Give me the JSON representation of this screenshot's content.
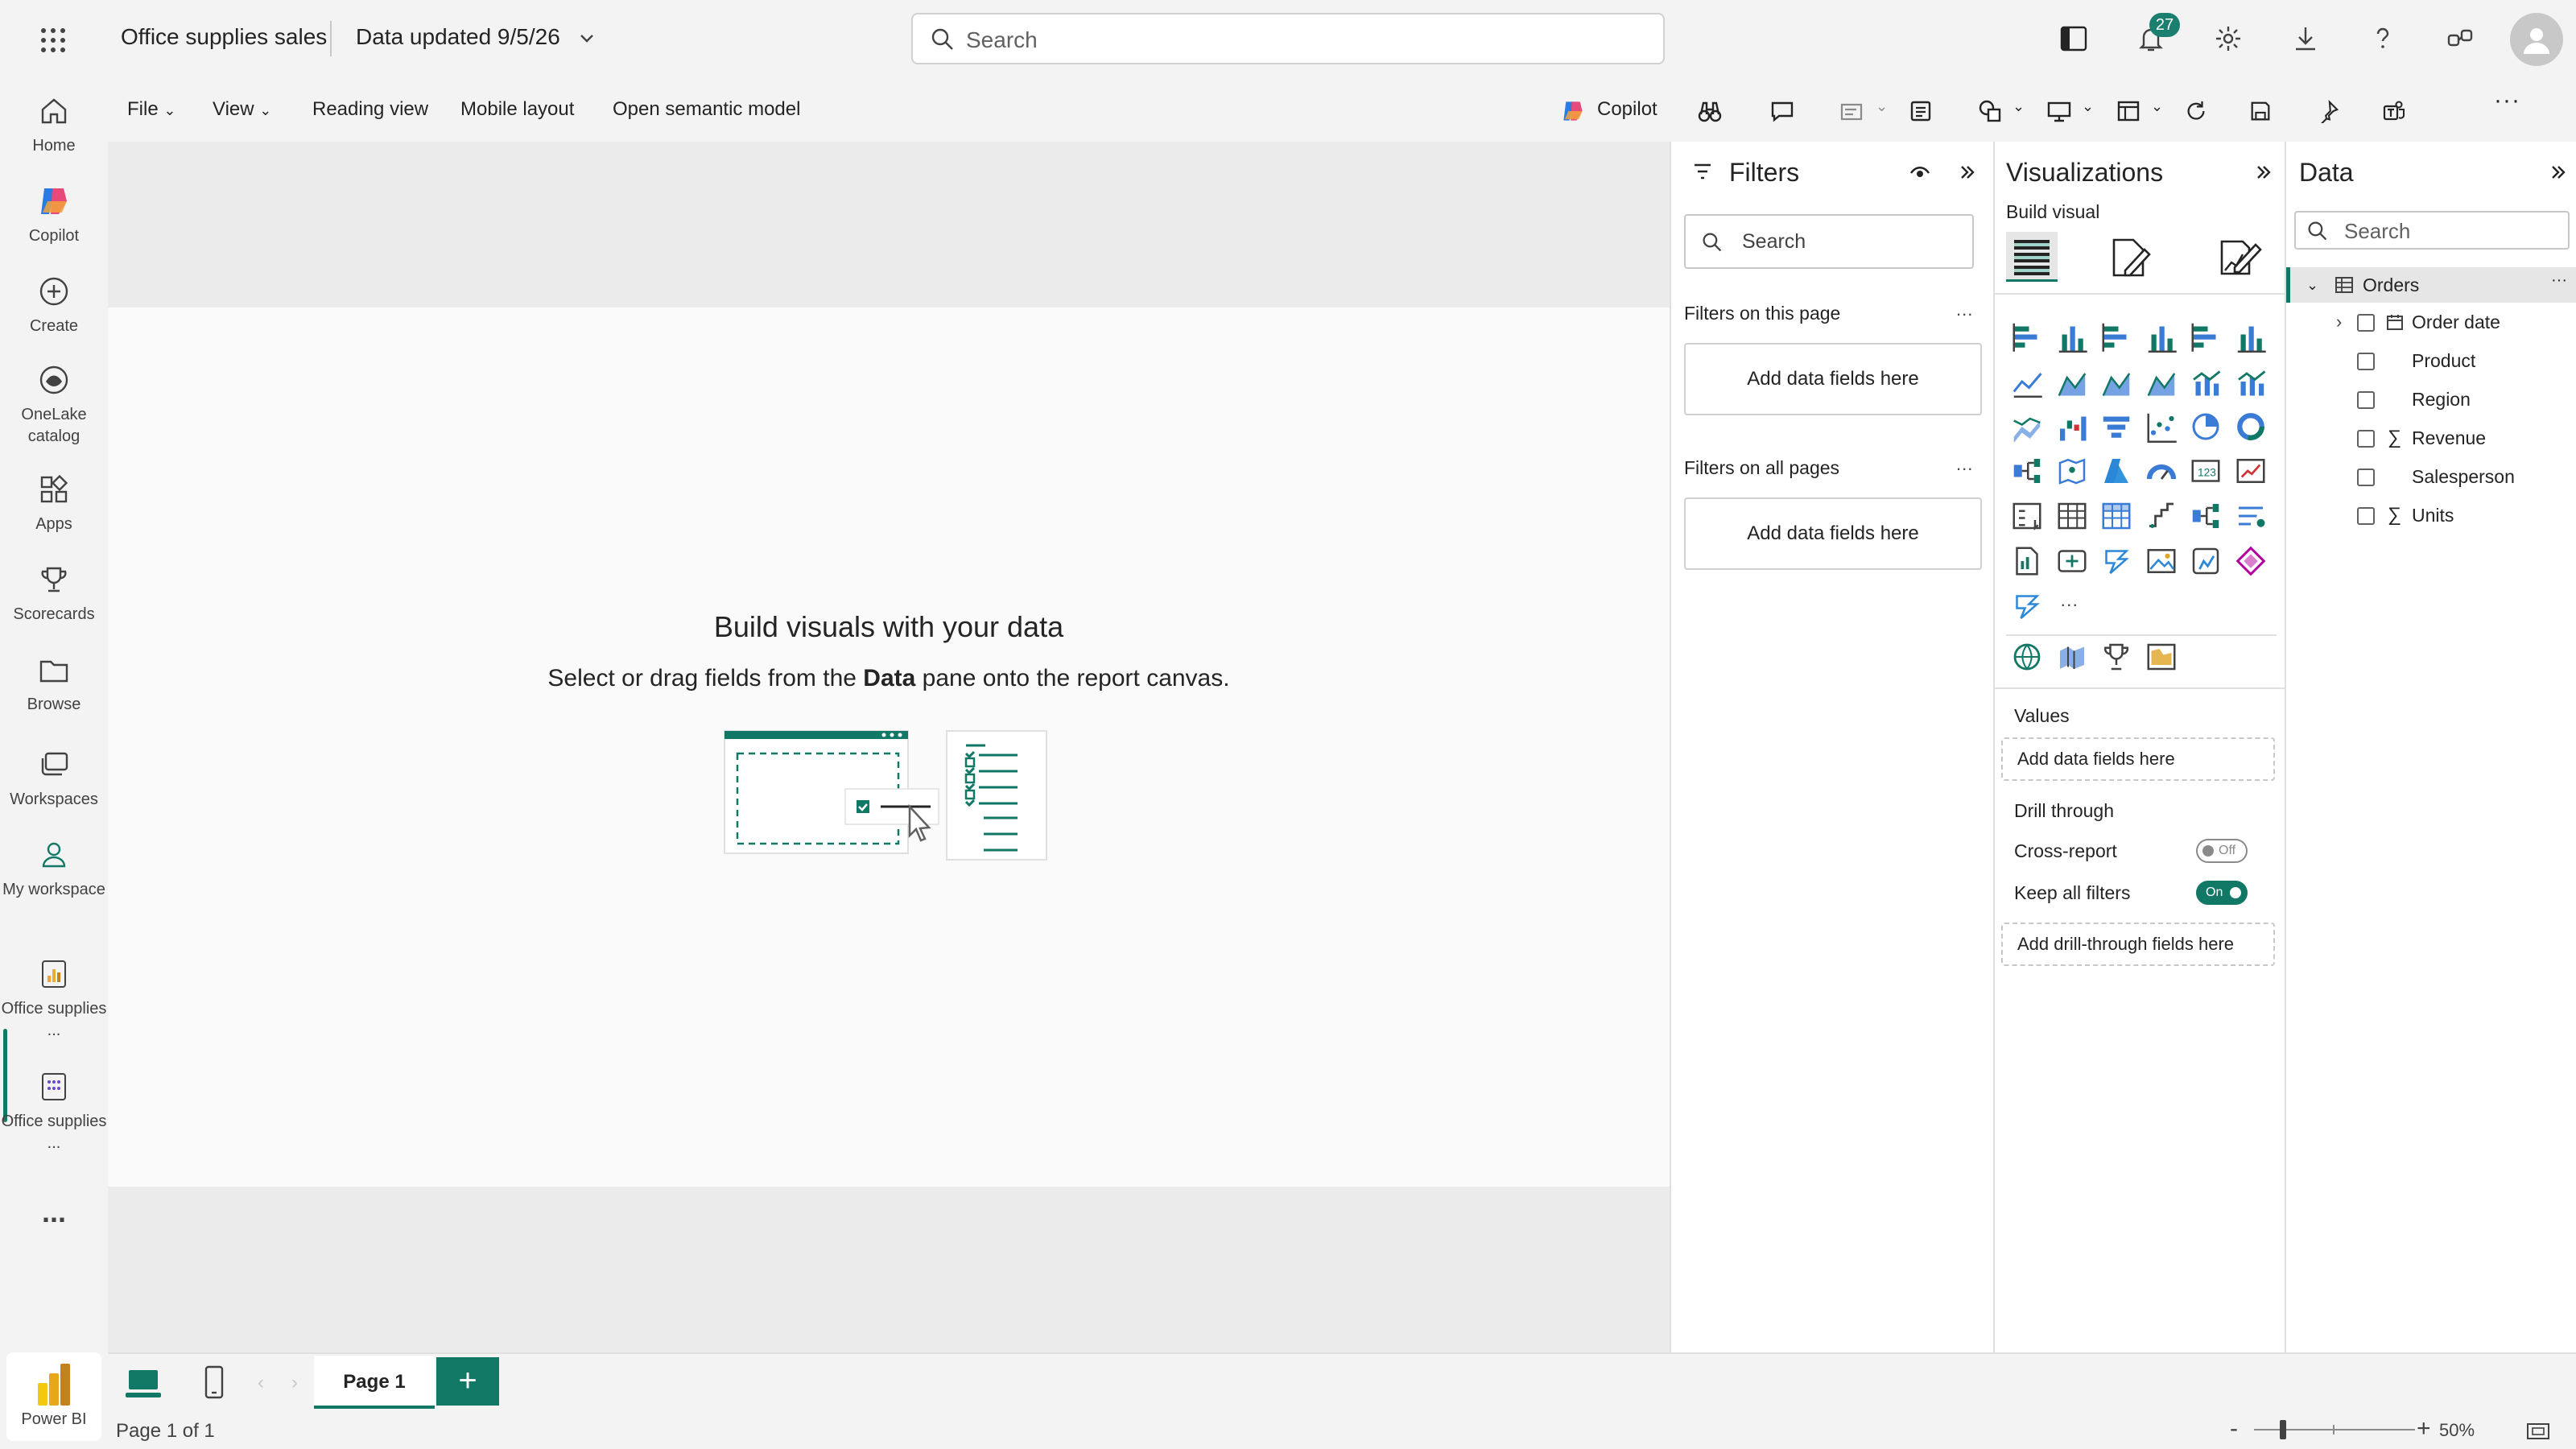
{
  "header": {
    "app_title": "Office supplies sales",
    "data_updated": "Data updated 9/5/26",
    "search_placeholder": "Search",
    "notification_count": "27"
  },
  "rail": {
    "items": [
      {
        "label": "Home",
        "icon": "home-icon"
      },
      {
        "label": "Copilot",
        "icon": "copilot-icon"
      },
      {
        "label": "Create",
        "icon": "create-icon"
      },
      {
        "label": "OneLake catalog",
        "icon": "onelake-icon"
      },
      {
        "label": "Apps",
        "icon": "apps-icon"
      },
      {
        "label": "Scorecards",
        "icon": "trophy-icon"
      },
      {
        "label": "Browse",
        "icon": "folder-icon"
      },
      {
        "label": "Workspaces",
        "icon": "workspaces-icon"
      },
      {
        "label": "My workspace",
        "icon": "person-icon"
      },
      {
        "label": "Office supplies ...",
        "icon": "report-icon"
      },
      {
        "label": "Office supplies ...",
        "icon": "semantic-model-icon"
      }
    ],
    "more": "...",
    "brand": "Power BI"
  },
  "ribbon": {
    "file": "File",
    "view": "View",
    "reading_view": "Reading view",
    "mobile_layout": "Mobile layout",
    "open_semantic_model": "Open semantic model",
    "copilot": "Copilot"
  },
  "canvas": {
    "empty_title": "Build visuals with your data",
    "empty_sub_pre": "Select or drag fields from the ",
    "empty_sub_bold": "Data",
    "empty_sub_post": " pane onto the report canvas."
  },
  "filters": {
    "title": "Filters",
    "search_placeholder": "Search",
    "on_this_page": "Filters on this page",
    "on_all_pages": "Filters on all pages",
    "add_fields": "Add data fields here",
    "more": "..."
  },
  "visualizations": {
    "title": "Visualizations",
    "build_visual": "Build visual",
    "values_label": "Values",
    "values_well": "Add data fields here",
    "drill_through": "Drill through",
    "cross_report": "Cross-report",
    "cross_report_state": "Off",
    "keep_all_filters": "Keep all filters",
    "keep_all_filters_state": "On",
    "drill_well": "Add drill-through fields here",
    "more": "..."
  },
  "data_pane": {
    "title": "Data",
    "search_placeholder": "Search",
    "table": "Orders",
    "fields": [
      {
        "name": "Order date",
        "kind": "date-hierarchy"
      },
      {
        "name": "Product",
        "kind": "text"
      },
      {
        "name": "Region",
        "kind": "text"
      },
      {
        "name": "Revenue",
        "kind": "sum"
      },
      {
        "name": "Salesperson",
        "kind": "text"
      },
      {
        "name": "Units",
        "kind": "sum"
      }
    ]
  },
  "pages": {
    "tabs": [
      "Page 1"
    ],
    "add": "+",
    "status": "Page 1 of 1",
    "zoom": "50%"
  },
  "colors": {
    "accent": "#117865",
    "canvas_bg": "#fafafa",
    "chrome_bg": "#f3f3f3"
  }
}
